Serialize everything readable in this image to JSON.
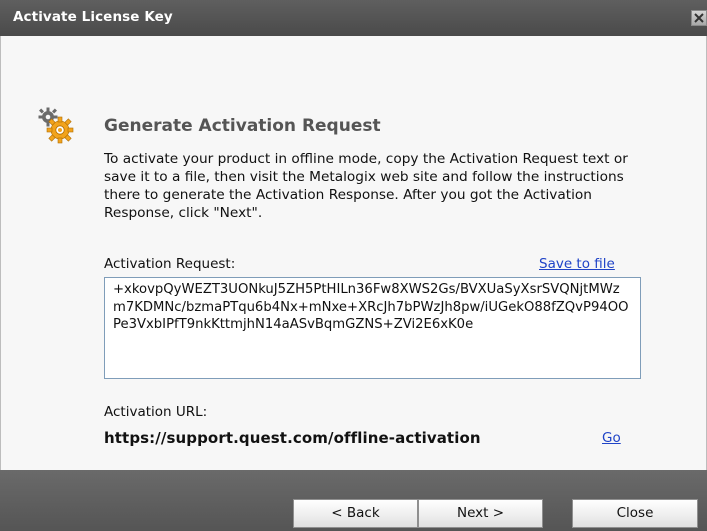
{
  "window": {
    "title": "Activate License Key"
  },
  "main": {
    "heading": "Generate Activation Request",
    "description": "To activate your product in offline mode, copy the Activation Request text or save it to a file, then visit the Metalogix web site and follow the instructions there to generate the Activation Response. After you got the Activation Response, click \"Next\".",
    "request_label": "Activation Request:",
    "save_link": "Save to file",
    "request_text": "+xkovpQyWEZT3UONkuJ5ZH5PtHILn36Fw8XWS2Gs/BVXUaSyXsrSVQNjtMWzm7KDMNc/bzmaPTqu6b4Nx+mNxe+XRcJh7bPWzJh8pw/iUGekO88fZQvP94OOPe3VxbIPfT9nkKttmjhN14aASvBqmGZNS+ZVi2E6xK0e",
    "url_label": "Activation URL:",
    "url_value": "https://support.quest.com/offline-activation",
    "go_link": "Go"
  },
  "footer": {
    "back_label": "< Back",
    "next_label": "Next >",
    "close_label": "Close"
  },
  "icons": {
    "header_icon": "gear-icon",
    "close": "close-icon"
  },
  "colors": {
    "titlebar": "#4f4f4f",
    "link": "#1f43c7",
    "gear_orange": "#f2a31c"
  }
}
